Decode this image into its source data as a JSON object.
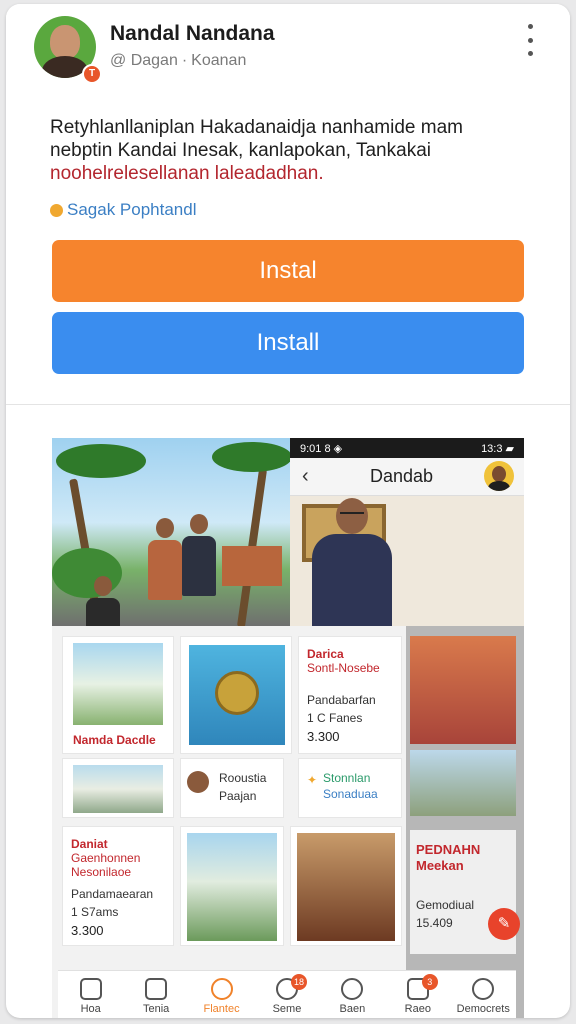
{
  "profile": {
    "name": "Nandal Nandana",
    "meta": [
      "@ Dagan",
      "·",
      "Koanan"
    ],
    "avatar_badge": "T"
  },
  "description": {
    "line1": "Retyhlanllaniplan Hakadanaidja nanhamide mam",
    "line2": "nebptin Kandai Inesak, kanlapokan, Tankakai",
    "line3_red": "noohelrelesellanan laleadadhan."
  },
  "tag": {
    "label": "Sagak Pophtandl"
  },
  "buttons": {
    "orange": "Instal",
    "blue": "Install"
  },
  "screenshot": {
    "status_left": "9:01 8 ◈",
    "status_right": "13:3 ▰",
    "title": "Dandab",
    "tiles": {
      "t1_caption": "Namda Dacdle",
      "t2_title": "Darica",
      "t2_sub": "Sontl-Nosebe",
      "t2_line1": "Pandabarfan",
      "t2_line2": "1 C Fanes",
      "t2_price": "3.300",
      "t3_title": "Rooustia",
      "t3_sub": "Paajan",
      "t4_title": "Stonnlan",
      "t4_sub": "Sonaduaa",
      "t5_title": "Daniat",
      "t5_sub": "Gaenhonnen",
      "t5_sub2": "Nesonilaoe",
      "t5_line1": "Pandamaearan",
      "t5_line2": "1 S7ams",
      "t5_price": "3.300",
      "promo_title": "PEDNAHN",
      "promo_sub": "Meekan",
      "promo_line1": "Gemodiual",
      "promo_line2": "15.409"
    },
    "nav": [
      {
        "label": "Hoa",
        "icon": "home-icon"
      },
      {
        "label": "Tenia",
        "icon": "store-icon"
      },
      {
        "label": "Flantec",
        "icon": "search-icon",
        "active": true
      },
      {
        "label": "Seme",
        "icon": "chat-icon",
        "badge": "18"
      },
      {
        "label": "Baen",
        "icon": "user-icon"
      },
      {
        "label": "Raeo",
        "icon": "bag-icon",
        "badge": "3"
      },
      {
        "label": "Democrets",
        "icon": "group-icon"
      }
    ]
  },
  "colors": {
    "accent_orange": "#f6842d",
    "accent_blue": "#3a8def",
    "red_text": "#b3262e"
  }
}
